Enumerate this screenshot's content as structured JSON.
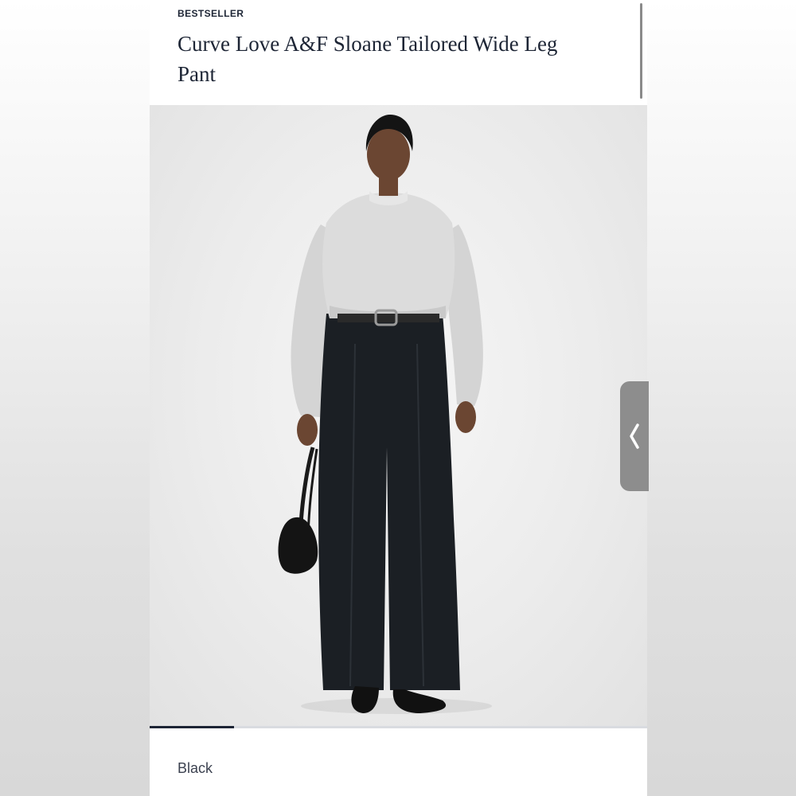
{
  "product": {
    "badge": "BESTSELLER",
    "title": "Curve Love A&F Sloane Tailored Wide Leg Pant",
    "color_name": "Black"
  },
  "gallery": {
    "progress": 0.17
  },
  "side_tab": {
    "icon": "chevron-left-icon"
  },
  "colors": {
    "text_dark": "#1d2535",
    "text_muted": "#3c4250",
    "tab_gray": "#8d8d8d"
  }
}
